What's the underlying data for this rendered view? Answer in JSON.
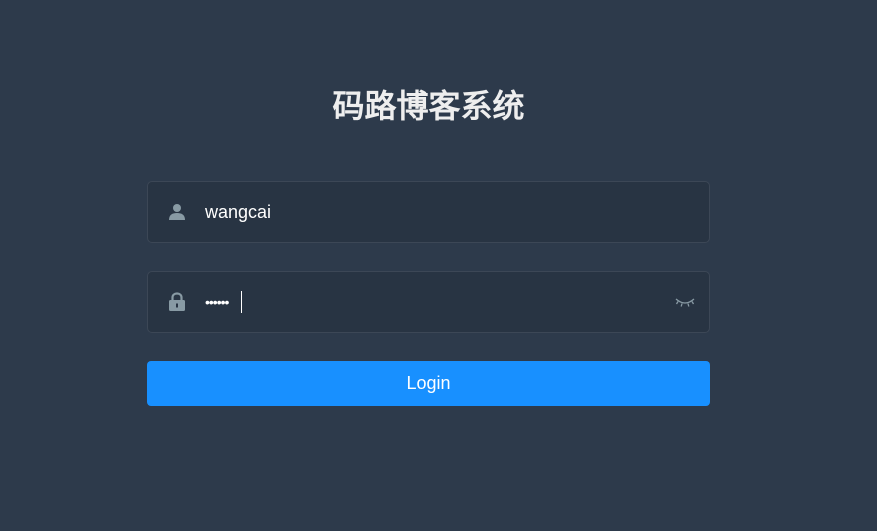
{
  "app": {
    "title": "码路博客系统"
  },
  "form": {
    "username": {
      "value": "wangcai",
      "icon": "user-icon"
    },
    "password": {
      "masked_value": "••••••",
      "icon": "lock-icon",
      "toggle_icon": "eye-closed-icon"
    },
    "login_label": "Login"
  },
  "colors": {
    "background": "#2d3a4b",
    "input_background": "#283443",
    "input_border": "#3c4756",
    "title_text": "#eeeeee",
    "icon": "#889aa4",
    "primary_button": "#1890ff"
  }
}
